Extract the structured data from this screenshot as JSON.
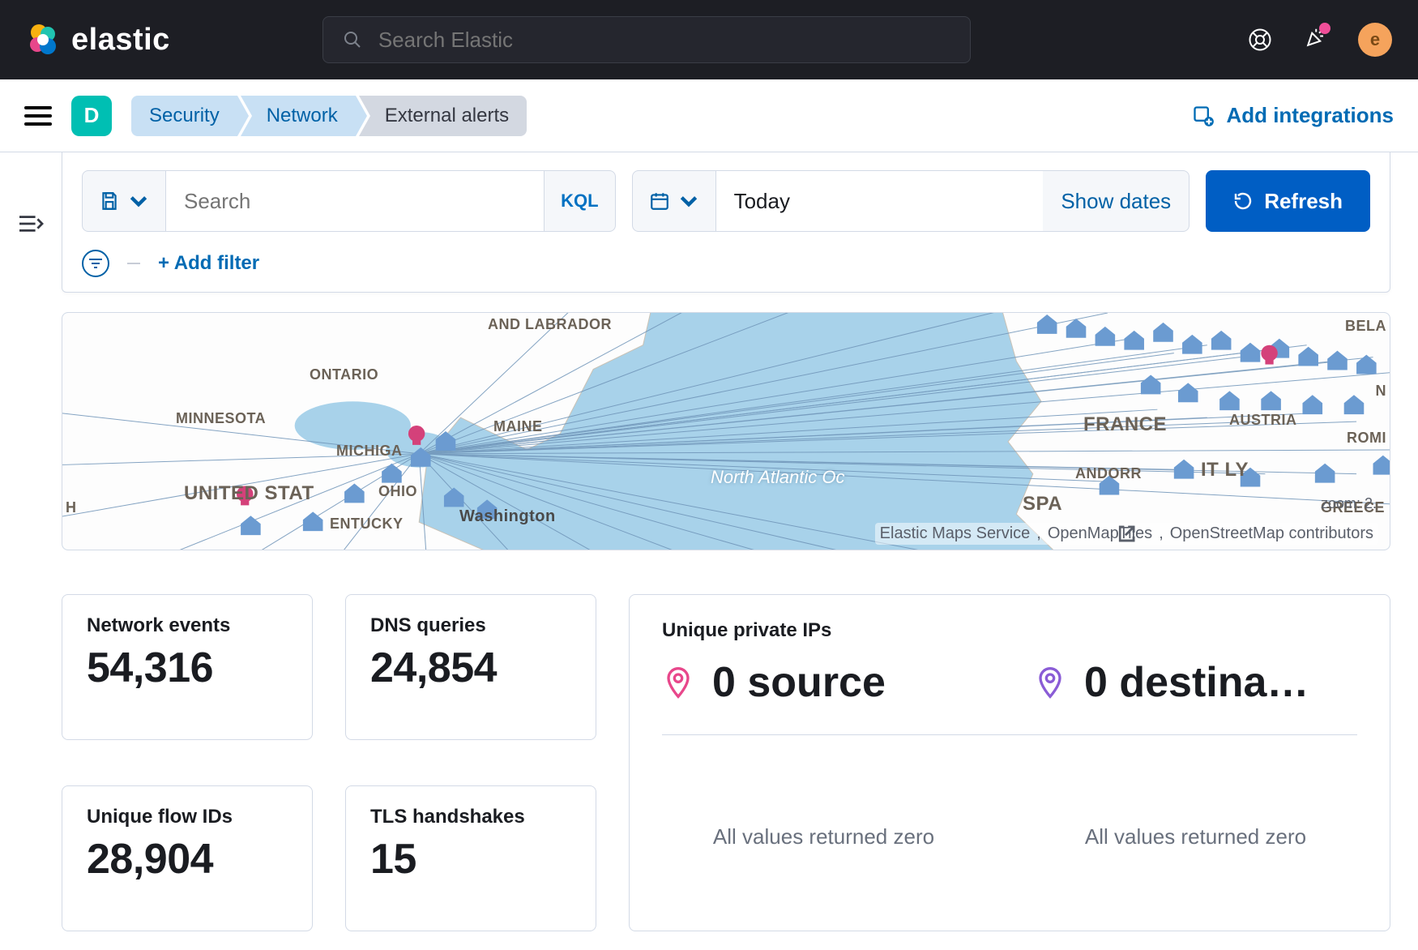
{
  "header": {
    "logo_text": "elastic",
    "search_placeholder": "Search Elastic",
    "avatar_letter": "e"
  },
  "breadcrumbs": {
    "space_letter": "D",
    "items": [
      "Security",
      "Network",
      "External alerts"
    ],
    "add_integrations": "Add integrations"
  },
  "query": {
    "search_placeholder": "Search",
    "kql_label": "KQL",
    "date_value": "Today",
    "show_dates": "Show dates",
    "refresh": "Refresh",
    "add_filter": "+ Add filter"
  },
  "map": {
    "labels": {
      "and_labrador": "AND LABRADOR",
      "ontario": "ONTARIO",
      "minnesota": "MINNESOTA",
      "michigan": "MICHIGA",
      "maine": "MAINE",
      "ohio": "OHIO",
      "kentucky": "ENTUCKY",
      "united_states": "UNITED STAT",
      "washington": "Washington",
      "h": "H",
      "france": "FRANCE",
      "austria": "AUSTRIA",
      "andorra": "ANDORR",
      "italy": "IT LY",
      "spain": "SPA",
      "greece": "GREECE",
      "romi": "ROMI",
      "bela": "BELA",
      "n": "N"
    },
    "ocean": "North Atlantic Oc",
    "zoom": "zoom: 2.",
    "attrib": {
      "ems": "Elastic Maps Service",
      "omt": "OpenMapTiles",
      "osm": "OpenStreetMap contributors"
    }
  },
  "stats": {
    "network_events": {
      "label": "Network events",
      "value": "54,316"
    },
    "dns_queries": {
      "label": "DNS queries",
      "value": "24,854"
    },
    "unique_flow": {
      "label": "Unique flow IDs",
      "value": "28,904"
    },
    "tls": {
      "label": "TLS handshakes",
      "value": "15"
    },
    "unique_ips": {
      "label": "Unique private IPs",
      "source": "0 source",
      "destination": "0 destina…",
      "zero_note": "All values returned zero"
    }
  }
}
